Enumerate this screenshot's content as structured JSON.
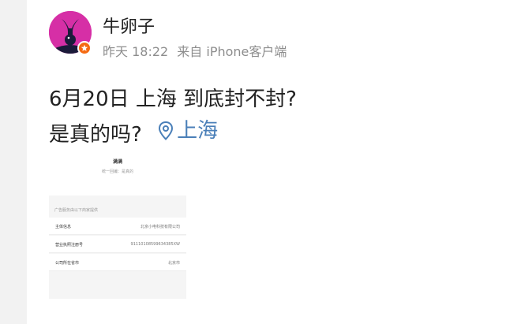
{
  "user": {
    "name": "牛卵子",
    "avatar_icon": "bunny-logo-icon",
    "badge_icon": "verified-badge-icon"
  },
  "meta": {
    "time": "昨天 18:22",
    "source": "来自 iPhone客户端"
  },
  "post": {
    "line1": "6月20日 上海 到底封不封?",
    "line2": "是真的吗?",
    "location": "上海",
    "location_icon": "map-pin-icon"
  },
  "attachment": {
    "title": "满满",
    "subtitle": "统一回编：是真的",
    "section_header": "广告服务由以下商家提供",
    "rows": [
      {
        "key": "主体信息",
        "value": "北京小电科技有限公司"
      },
      {
        "key": "营业执照注册号",
        "value": "91110108599634385XW"
      },
      {
        "key": "公司所在省市",
        "value": "北京市"
      }
    ]
  },
  "colors": {
    "link": "#4a7fb8",
    "avatar_bg": "#d62fa6",
    "badge": "#f56a12",
    "meta_text": "#8d8d8d"
  }
}
